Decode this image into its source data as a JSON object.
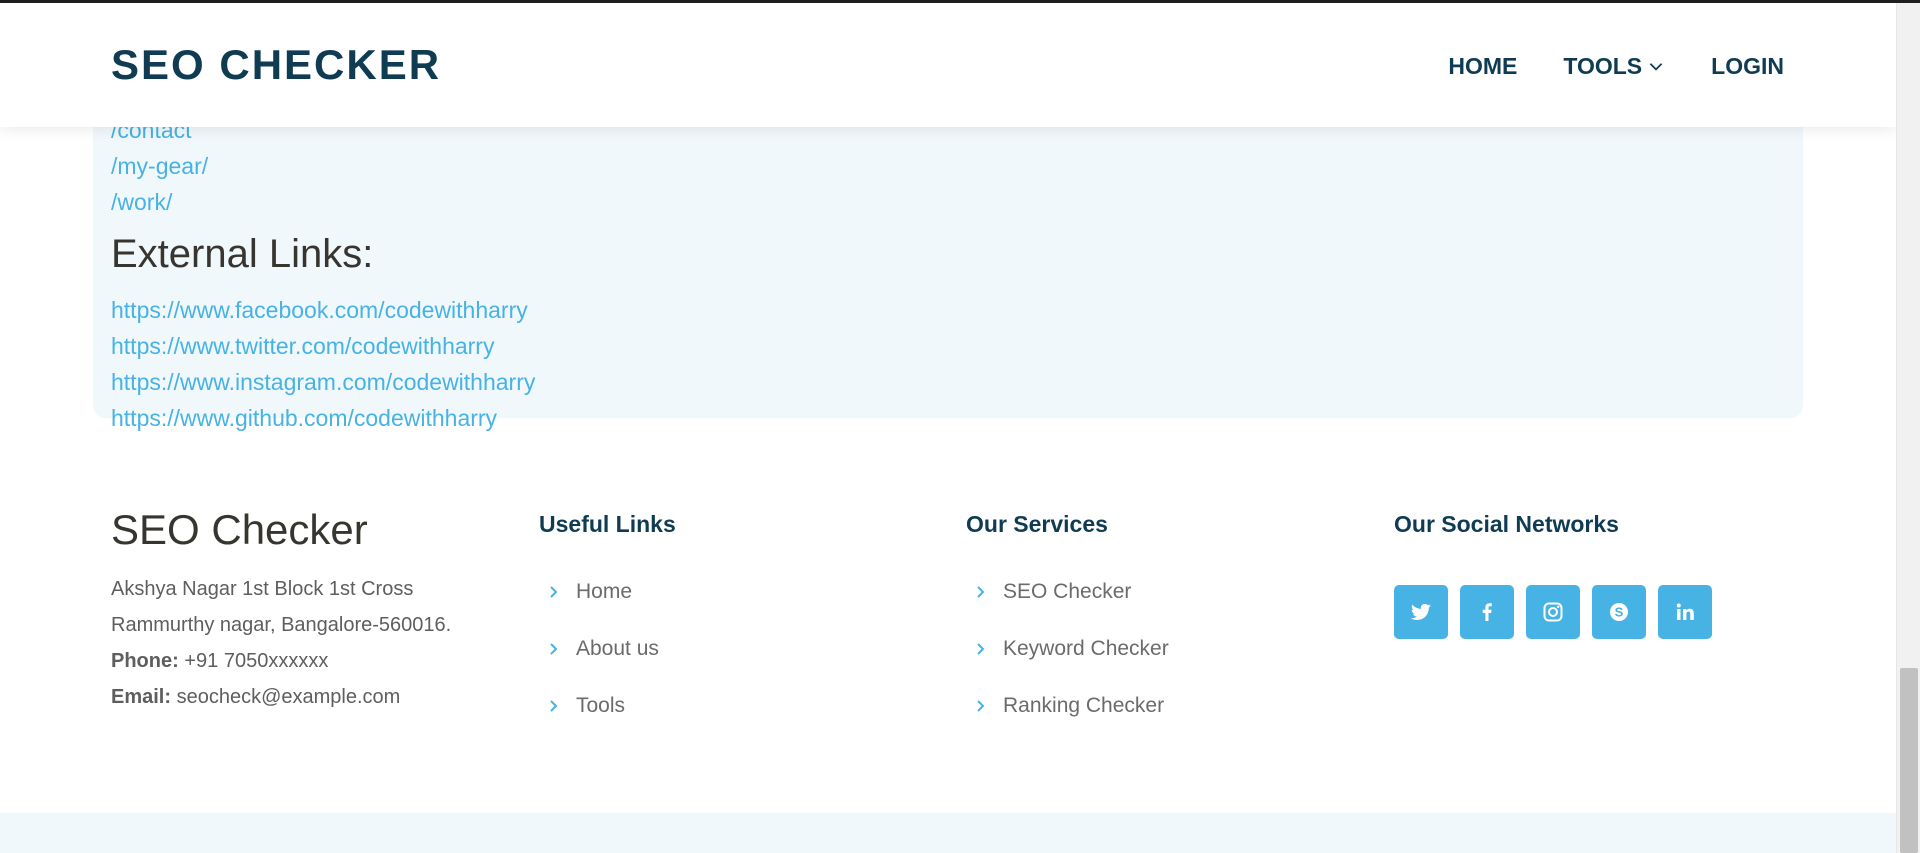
{
  "header": {
    "logo": "SEO CHECKER",
    "nav": [
      {
        "label": "HOME"
      },
      {
        "label": "TOOLS"
      },
      {
        "label": "LOGIN"
      }
    ]
  },
  "internal_links": {
    "partial_top": "/contact",
    "items": [
      "/my-gear/",
      "/work/"
    ]
  },
  "external_links": {
    "heading": "External Links:",
    "items": [
      "https://www.facebook.com/codewithharry",
      "https://www.twitter.com/codewithharry",
      "https://www.instagram.com/codewithharry",
      "https://www.github.com/codewithharry"
    ]
  },
  "footer": {
    "brand": {
      "title": "SEO Checker",
      "address_line1": "Akshya Nagar 1st Block 1st Cross",
      "address_line2": "Rammurthy nagar, Bangalore-560016.",
      "phone_label": "Phone:",
      "phone": " +91 7050xxxxxx",
      "email_label": "Email:",
      "email": " seocheck@example.com"
    },
    "useful_links": {
      "title": "Useful Links",
      "items": [
        "Home",
        "About us",
        "Tools"
      ]
    },
    "services": {
      "title": "Our Services",
      "items": [
        "SEO Checker",
        "Keyword Checker",
        "Ranking Checker"
      ]
    },
    "social": {
      "title": "Our Social Networks",
      "icons": [
        "twitter-icon",
        "facebook-icon",
        "instagram-icon",
        "skype-icon",
        "linkedin-icon"
      ]
    }
  },
  "colors": {
    "accent": "#47b2e4",
    "heading": "#0f3b53",
    "panel_bg": "#f1f8fc"
  }
}
